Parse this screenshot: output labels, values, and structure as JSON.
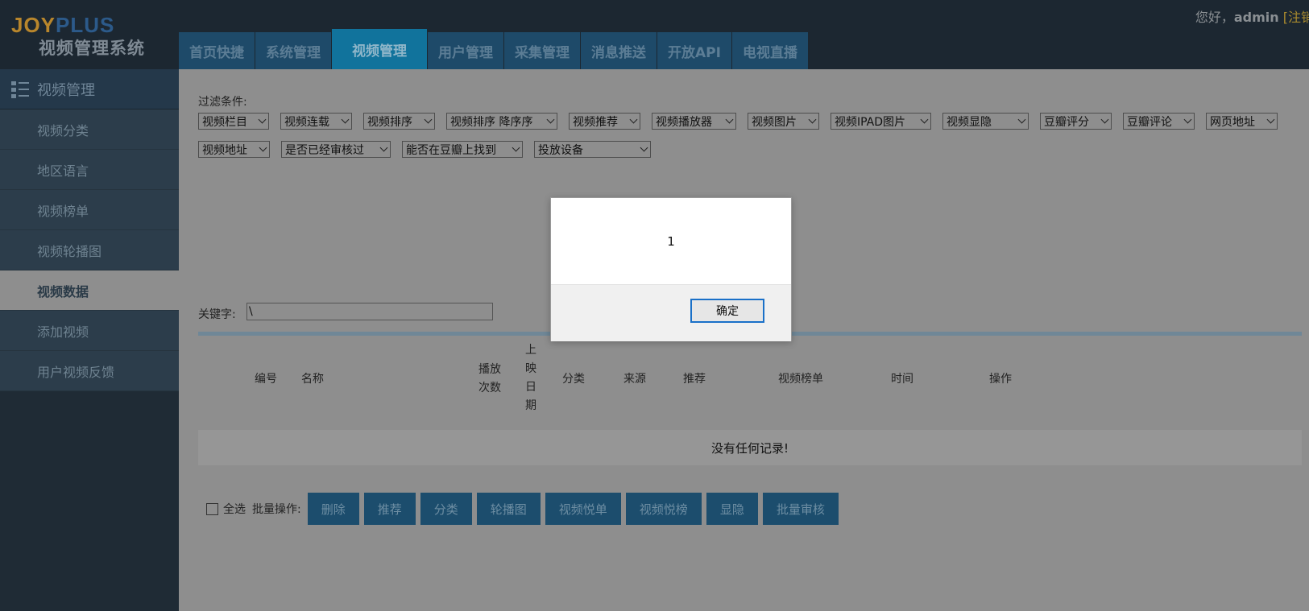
{
  "header": {
    "logo_part1": "JOY",
    "logo_part2": "PLUS",
    "subtitle": "视频管理系统",
    "greeting_prefix": "您好，",
    "user": "admin",
    "logout": "[注销"
  },
  "topnav": {
    "tabs": [
      {
        "label": "首页快捷"
      },
      {
        "label": "系统管理"
      },
      {
        "label": "视频管理",
        "active": true
      },
      {
        "label": "用户管理"
      },
      {
        "label": "采集管理"
      },
      {
        "label": "消息推送"
      },
      {
        "label": "开放API"
      },
      {
        "label": "电视直播"
      }
    ]
  },
  "sidebar": {
    "title": "视频管理",
    "items": [
      {
        "label": "视频分类"
      },
      {
        "label": "地区语言"
      },
      {
        "label": "视频榜单"
      },
      {
        "label": "视频轮播图"
      },
      {
        "label": "视频数据",
        "active": true
      },
      {
        "label": "添加视频"
      },
      {
        "label": "用户视频反馈"
      }
    ]
  },
  "filters": {
    "label": "过滤条件:",
    "selects": [
      {
        "value": "视频栏目"
      },
      {
        "value": "视频连载"
      },
      {
        "value": "视频排序"
      },
      {
        "value": "视频排序 降序序"
      },
      {
        "value": "视频推荐"
      },
      {
        "value": "视频播放器"
      },
      {
        "value": "视频图片"
      },
      {
        "value": "视频IPAD图片"
      },
      {
        "value": "视频显隐"
      },
      {
        "value": "豆瓣评分"
      },
      {
        "value": "豆瓣评论"
      },
      {
        "value": "网页地址"
      },
      {
        "value": "视频地址"
      },
      {
        "value": "是否已经审核过"
      },
      {
        "value": "能否在豆瓣上找到"
      },
      {
        "value": "投放设备"
      }
    ]
  },
  "search": {
    "label": "关键字:",
    "value": "\\"
  },
  "table": {
    "headers": {
      "id": "编号",
      "name": "名称",
      "plays_1": "播放",
      "plays_2": "次数",
      "release_1": "上",
      "release_2": "映",
      "release_3": "日",
      "release_4": "期",
      "category": "分类",
      "source": "来源",
      "recommend": "推荐",
      "ranking": "视频榜单",
      "time": "时间",
      "actions": "操作"
    },
    "empty_message": "没有任何记录!"
  },
  "batch": {
    "select_all": "全选",
    "label": "批量操作:",
    "buttons": [
      "删除",
      "推荐",
      "分类",
      "轮播图",
      "视频悦单",
      "视频悦榜",
      "显隐",
      "批量审核"
    ]
  },
  "dialog": {
    "message": "1",
    "ok_label": "确定"
  }
}
